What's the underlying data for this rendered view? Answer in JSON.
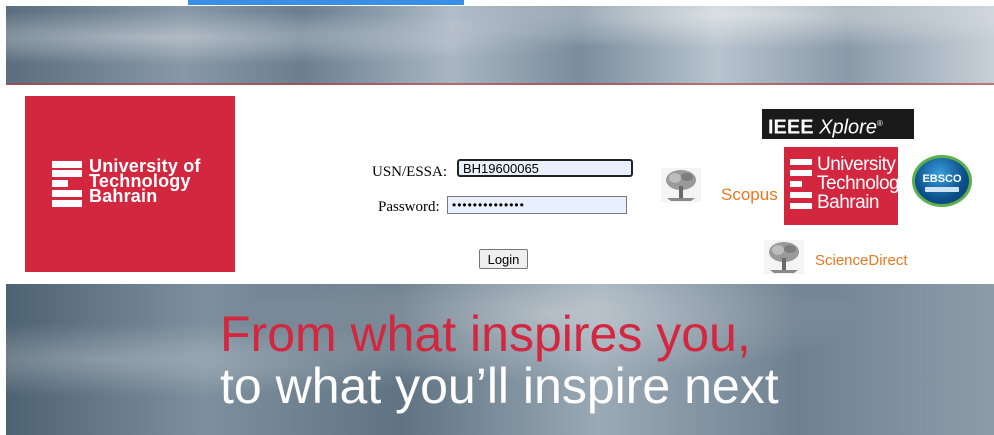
{
  "logo_main": {
    "lines": [
      "University of",
      "Technology",
      "Bahrain"
    ]
  },
  "form": {
    "usn_label": "USN/ESSA:",
    "usn_value": "BH19600065",
    "password_label": "Password:",
    "password_value": "••••••••••••••",
    "login_label": "Login"
  },
  "partners": {
    "ieee_bold": "IEEE",
    "ieee_italic": "Xplore",
    "ieee_mark": "®",
    "scopus": "Scopus",
    "sciencedirect": "ScienceDirect",
    "utb_lines": [
      "University of",
      "Technology",
      "Bahrain"
    ],
    "ebsco": "EBSCO"
  },
  "slogan": {
    "line1": "From what inspires you,",
    "line2": "to what you’ll inspire next"
  },
  "colors": {
    "brand_red": "#d3263f",
    "elsevier_orange": "#e8771f",
    "top_bar_blue": "#3a8ee6"
  }
}
